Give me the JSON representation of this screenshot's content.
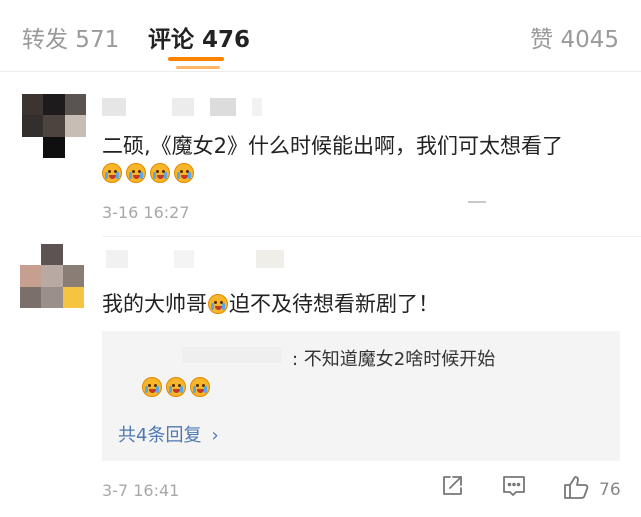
{
  "tabs": {
    "repost": "转发 571",
    "comments": "评论 476",
    "likes": "赞 4045"
  },
  "colors": {
    "accent": "#ff8200",
    "link": "#4e79b3",
    "reply_bg": "#f4f4f4"
  },
  "comments": [
    {
      "text": "二硕,《魔女2》什么时候能出啊，我们可太想看了",
      "emojis": [
        "crying-emoji",
        "crying-emoji",
        "crying-emoji",
        "crying-emoji"
      ],
      "time": "3-16 16:27"
    },
    {
      "text_before": "我的大帅哥",
      "text_after": "迫不及待想看新剧了！",
      "time": "3-7 16:41",
      "reply": {
        "text": ": 不知道魔女2啥时候开始",
        "emojis": [
          "crying-emoji",
          "crying-emoji",
          "crying-emoji"
        ],
        "more": "共4条回复"
      },
      "like_count": "76"
    }
  ],
  "icons": {
    "share": "share-icon",
    "reply": "comment-icon",
    "like": "thumbs-up-icon",
    "more": "chevron-right-icon"
  }
}
